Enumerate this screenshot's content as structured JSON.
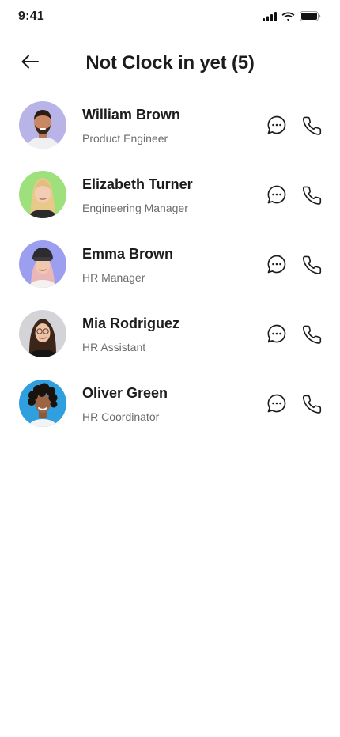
{
  "status_bar": {
    "time": "9:41",
    "icons": [
      "signal-icon",
      "wifi-icon",
      "battery-icon"
    ]
  },
  "header": {
    "back_icon": "arrow-left-icon",
    "title": "Not Clock in yet (5)"
  },
  "employees": [
    {
      "name": "William Brown",
      "role": "Product Engineer",
      "avatar_bg": "#b8b4e8"
    },
    {
      "name": "Elizabeth Turner",
      "role": "Engineering Manager",
      "avatar_bg": "#9ee07c"
    },
    {
      "name": "Emma Brown",
      "role": "HR Manager",
      "avatar_bg": "#9c9ef0"
    },
    {
      "name": "Mia Rodriguez",
      "role": "HR Assistant",
      "avatar_bg": "#d4d4d8"
    },
    {
      "name": "Oliver Green",
      "role": "HR Coordinator",
      "avatar_bg": "#2f9fe0"
    }
  ],
  "actions": {
    "message_icon": "chat-bubble-icon",
    "call_icon": "phone-icon"
  }
}
